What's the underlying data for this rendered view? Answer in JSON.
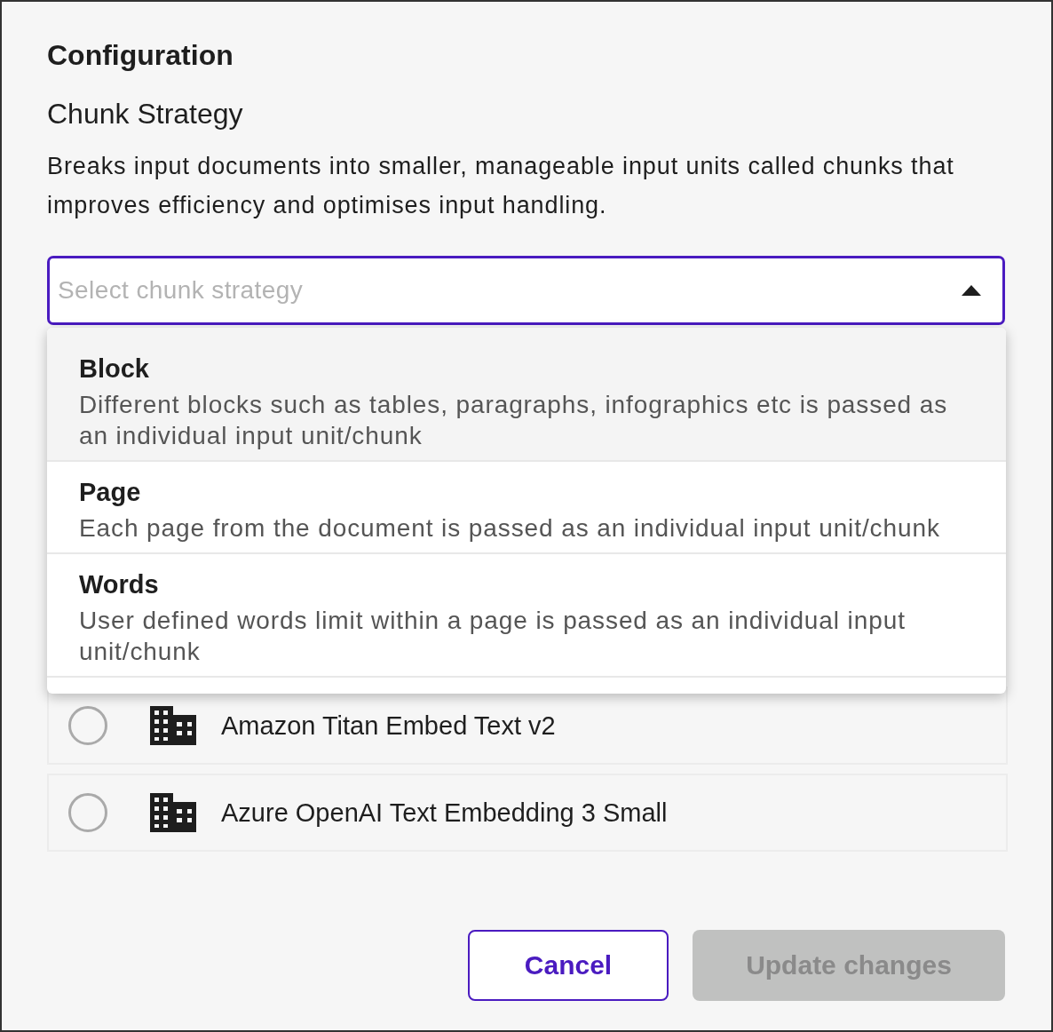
{
  "title": "Configuration",
  "section": {
    "title": "Chunk Strategy",
    "description": "Breaks input documents into smaller, manageable input units called chunks that improves efficiency and optimises input handling."
  },
  "select": {
    "placeholder": "Select chunk strategy",
    "expanded": true
  },
  "menu": [
    {
      "label": "Block",
      "description": "Different blocks such as tables, paragraphs, infographics etc is passed as an individual input unit/chunk",
      "selected": true
    },
    {
      "label": "Page",
      "description": "Each page from the document is passed as an individual input unit/chunk",
      "selected": false
    },
    {
      "label": "Words",
      "description": "User defined words limit within a page is passed as an individual input unit/chunk",
      "selected": false
    }
  ],
  "models": [
    {
      "name": "Amazon Titan Embed Text v2",
      "selected": false
    },
    {
      "name": "Azure OpenAI Text Embedding 3 Small",
      "selected": false
    }
  ],
  "buttons": [
    {
      "label": "Cancel",
      "kind": "outline",
      "disabled": false
    },
    {
      "label": "Update changes",
      "kind": "primary",
      "disabled": true
    }
  ]
}
